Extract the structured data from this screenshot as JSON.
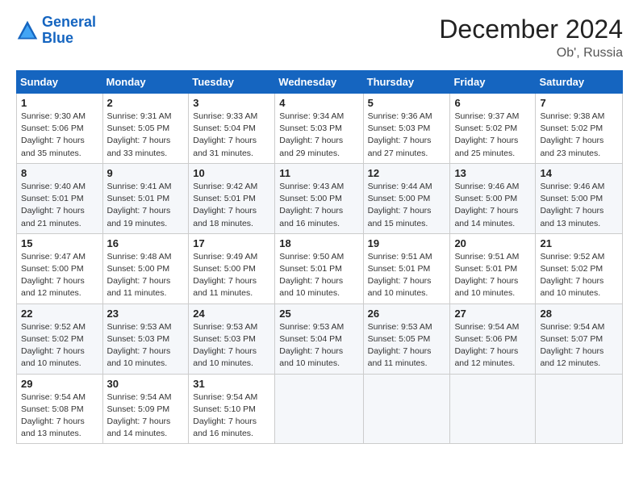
{
  "logo": {
    "line1": "General",
    "line2": "Blue"
  },
  "title": "December 2024",
  "subtitle": "Ob', Russia",
  "days_header": [
    "Sunday",
    "Monday",
    "Tuesday",
    "Wednesday",
    "Thursday",
    "Friday",
    "Saturday"
  ],
  "weeks": [
    [
      {
        "day": "1",
        "sunrise": "Sunrise: 9:30 AM",
        "sunset": "Sunset: 5:06 PM",
        "daylight": "Daylight: 7 hours and 35 minutes."
      },
      {
        "day": "2",
        "sunrise": "Sunrise: 9:31 AM",
        "sunset": "Sunset: 5:05 PM",
        "daylight": "Daylight: 7 hours and 33 minutes."
      },
      {
        "day": "3",
        "sunrise": "Sunrise: 9:33 AM",
        "sunset": "Sunset: 5:04 PM",
        "daylight": "Daylight: 7 hours and 31 minutes."
      },
      {
        "day": "4",
        "sunrise": "Sunrise: 9:34 AM",
        "sunset": "Sunset: 5:03 PM",
        "daylight": "Daylight: 7 hours and 29 minutes."
      },
      {
        "day": "5",
        "sunrise": "Sunrise: 9:36 AM",
        "sunset": "Sunset: 5:03 PM",
        "daylight": "Daylight: 7 hours and 27 minutes."
      },
      {
        "day": "6",
        "sunrise": "Sunrise: 9:37 AM",
        "sunset": "Sunset: 5:02 PM",
        "daylight": "Daylight: 7 hours and 25 minutes."
      },
      {
        "day": "7",
        "sunrise": "Sunrise: 9:38 AM",
        "sunset": "Sunset: 5:02 PM",
        "daylight": "Daylight: 7 hours and 23 minutes."
      }
    ],
    [
      {
        "day": "8",
        "sunrise": "Sunrise: 9:40 AM",
        "sunset": "Sunset: 5:01 PM",
        "daylight": "Daylight: 7 hours and 21 minutes."
      },
      {
        "day": "9",
        "sunrise": "Sunrise: 9:41 AM",
        "sunset": "Sunset: 5:01 PM",
        "daylight": "Daylight: 7 hours and 19 minutes."
      },
      {
        "day": "10",
        "sunrise": "Sunrise: 9:42 AM",
        "sunset": "Sunset: 5:01 PM",
        "daylight": "Daylight: 7 hours and 18 minutes."
      },
      {
        "day": "11",
        "sunrise": "Sunrise: 9:43 AM",
        "sunset": "Sunset: 5:00 PM",
        "daylight": "Daylight: 7 hours and 16 minutes."
      },
      {
        "day": "12",
        "sunrise": "Sunrise: 9:44 AM",
        "sunset": "Sunset: 5:00 PM",
        "daylight": "Daylight: 7 hours and 15 minutes."
      },
      {
        "day": "13",
        "sunrise": "Sunrise: 9:46 AM",
        "sunset": "Sunset: 5:00 PM",
        "daylight": "Daylight: 7 hours and 14 minutes."
      },
      {
        "day": "14",
        "sunrise": "Sunrise: 9:46 AM",
        "sunset": "Sunset: 5:00 PM",
        "daylight": "Daylight: 7 hours and 13 minutes."
      }
    ],
    [
      {
        "day": "15",
        "sunrise": "Sunrise: 9:47 AM",
        "sunset": "Sunset: 5:00 PM",
        "daylight": "Daylight: 7 hours and 12 minutes."
      },
      {
        "day": "16",
        "sunrise": "Sunrise: 9:48 AM",
        "sunset": "Sunset: 5:00 PM",
        "daylight": "Daylight: 7 hours and 11 minutes."
      },
      {
        "day": "17",
        "sunrise": "Sunrise: 9:49 AM",
        "sunset": "Sunset: 5:00 PM",
        "daylight": "Daylight: 7 hours and 11 minutes."
      },
      {
        "day": "18",
        "sunrise": "Sunrise: 9:50 AM",
        "sunset": "Sunset: 5:01 PM",
        "daylight": "Daylight: 7 hours and 10 minutes."
      },
      {
        "day": "19",
        "sunrise": "Sunrise: 9:51 AM",
        "sunset": "Sunset: 5:01 PM",
        "daylight": "Daylight: 7 hours and 10 minutes."
      },
      {
        "day": "20",
        "sunrise": "Sunrise: 9:51 AM",
        "sunset": "Sunset: 5:01 PM",
        "daylight": "Daylight: 7 hours and 10 minutes."
      },
      {
        "day": "21",
        "sunrise": "Sunrise: 9:52 AM",
        "sunset": "Sunset: 5:02 PM",
        "daylight": "Daylight: 7 hours and 10 minutes."
      }
    ],
    [
      {
        "day": "22",
        "sunrise": "Sunrise: 9:52 AM",
        "sunset": "Sunset: 5:02 PM",
        "daylight": "Daylight: 7 hours and 10 minutes."
      },
      {
        "day": "23",
        "sunrise": "Sunrise: 9:53 AM",
        "sunset": "Sunset: 5:03 PM",
        "daylight": "Daylight: 7 hours and 10 minutes."
      },
      {
        "day": "24",
        "sunrise": "Sunrise: 9:53 AM",
        "sunset": "Sunset: 5:03 PM",
        "daylight": "Daylight: 7 hours and 10 minutes."
      },
      {
        "day": "25",
        "sunrise": "Sunrise: 9:53 AM",
        "sunset": "Sunset: 5:04 PM",
        "daylight": "Daylight: 7 hours and 10 minutes."
      },
      {
        "day": "26",
        "sunrise": "Sunrise: 9:53 AM",
        "sunset": "Sunset: 5:05 PM",
        "daylight": "Daylight: 7 hours and 11 minutes."
      },
      {
        "day": "27",
        "sunrise": "Sunrise: 9:54 AM",
        "sunset": "Sunset: 5:06 PM",
        "daylight": "Daylight: 7 hours and 12 minutes."
      },
      {
        "day": "28",
        "sunrise": "Sunrise: 9:54 AM",
        "sunset": "Sunset: 5:07 PM",
        "daylight": "Daylight: 7 hours and 12 minutes."
      }
    ],
    [
      {
        "day": "29",
        "sunrise": "Sunrise: 9:54 AM",
        "sunset": "Sunset: 5:08 PM",
        "daylight": "Daylight: 7 hours and 13 minutes."
      },
      {
        "day": "30",
        "sunrise": "Sunrise: 9:54 AM",
        "sunset": "Sunset: 5:09 PM",
        "daylight": "Daylight: 7 hours and 14 minutes."
      },
      {
        "day": "31",
        "sunrise": "Sunrise: 9:54 AM",
        "sunset": "Sunset: 5:10 PM",
        "daylight": "Daylight: 7 hours and 16 minutes."
      },
      null,
      null,
      null,
      null
    ]
  ]
}
